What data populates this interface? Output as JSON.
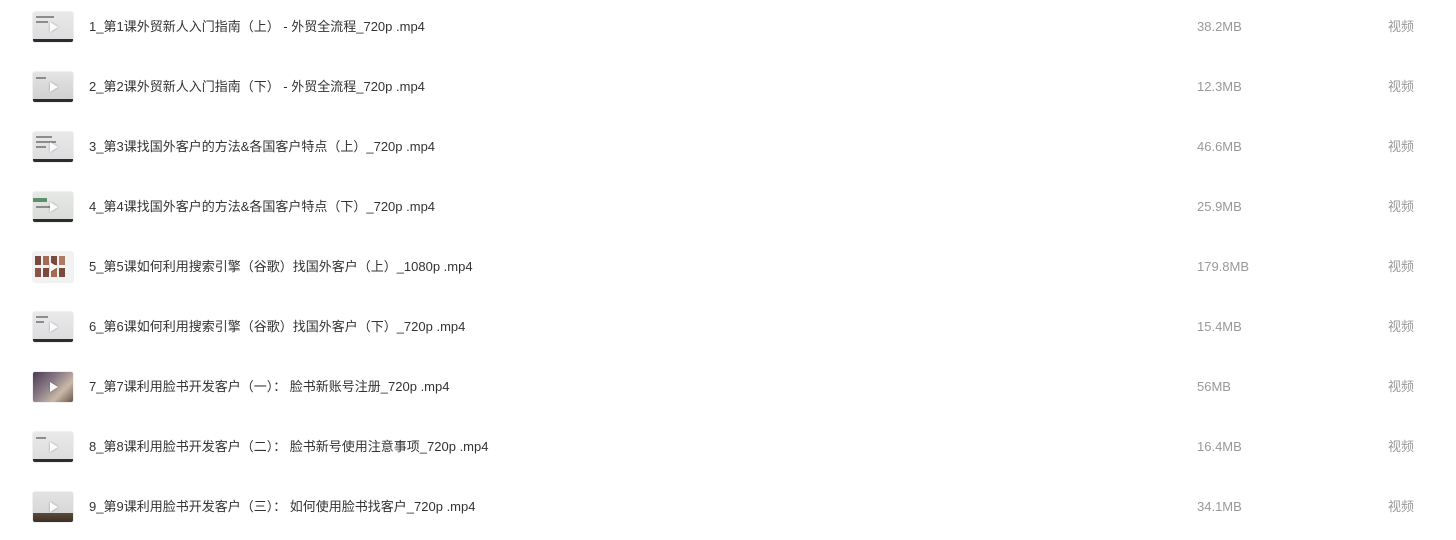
{
  "files": [
    {
      "name": "1_第1课外贸新人入门指南（上） - 外贸全流程_720p .mp4",
      "size": "38.2MB",
      "type": "视频"
    },
    {
      "name": "2_第2课外贸新人入门指南（下） - 外贸全流程_720p .mp4",
      "size": "12.3MB",
      "type": "视频"
    },
    {
      "name": "3_第3课找国外客户的方法&各国客户特点（上）_720p .mp4",
      "size": "46.6MB",
      "type": "视频"
    },
    {
      "name": "4_第4课找国外客户的方法&各国客户特点（下）_720p .mp4",
      "size": "25.9MB",
      "type": "视频"
    },
    {
      "name": "5_第5课如何利用搜索引擎（谷歌）找国外客户（上）_1080p .mp4",
      "size": "179.8MB",
      "type": "视频"
    },
    {
      "name": "6_第6课如何利用搜索引擎（谷歌）找国外客户（下）_720p .mp4",
      "size": "15.4MB",
      "type": "视频"
    },
    {
      "name": "7_第7课利用脸书开发客户（一）： 脸书新账号注册_720p .mp4",
      "size": "56MB",
      "type": "视频"
    },
    {
      "name": "8_第8课利用脸书开发客户（二）： 脸书新号使用注意事项_720p .mp4",
      "size": "16.4MB",
      "type": "视频"
    },
    {
      "name": "9_第9课利用脸书开发客户（三）： 如何使用脸书找客户_720p .mp4",
      "size": "34.1MB",
      "type": "视频"
    }
  ]
}
